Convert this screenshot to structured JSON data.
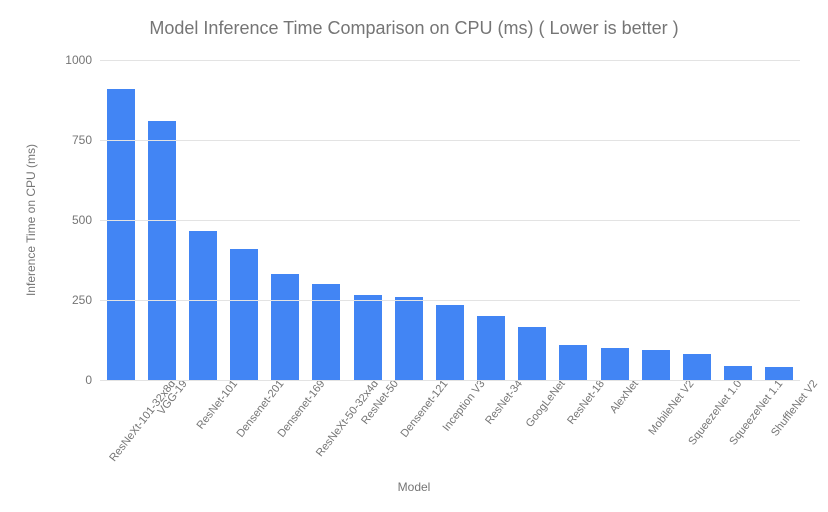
{
  "chart_data": {
    "type": "bar",
    "title": "Model Inference Time Comparison on CPU (ms) ( Lower is better )",
    "xlabel": "Model",
    "ylabel": "Inference Time on CPU (ms)",
    "ylim": [
      0,
      1000
    ],
    "yticks": [
      0,
      250,
      500,
      750,
      1000
    ],
    "bar_color": "#4285f4",
    "categories": [
      "ResNeXt-101-32x8d",
      "VGG-19",
      "ResNet-101",
      "Densenet-201",
      "Densenet-169",
      "ResNeXt-50-32x4d",
      "ResNet-50",
      "Densenet-121",
      "Inception V3",
      "ResNet-34",
      "GoogLeNet",
      "ResNet-18",
      "AlexNet",
      "MobileNet V2",
      "SqueezeNet 1.0",
      "SqueezeNet 1.1",
      "ShuffleNet V2"
    ],
    "values": [
      910,
      810,
      465,
      410,
      330,
      300,
      265,
      260,
      235,
      200,
      165,
      110,
      100,
      95,
      80,
      45,
      40
    ]
  }
}
